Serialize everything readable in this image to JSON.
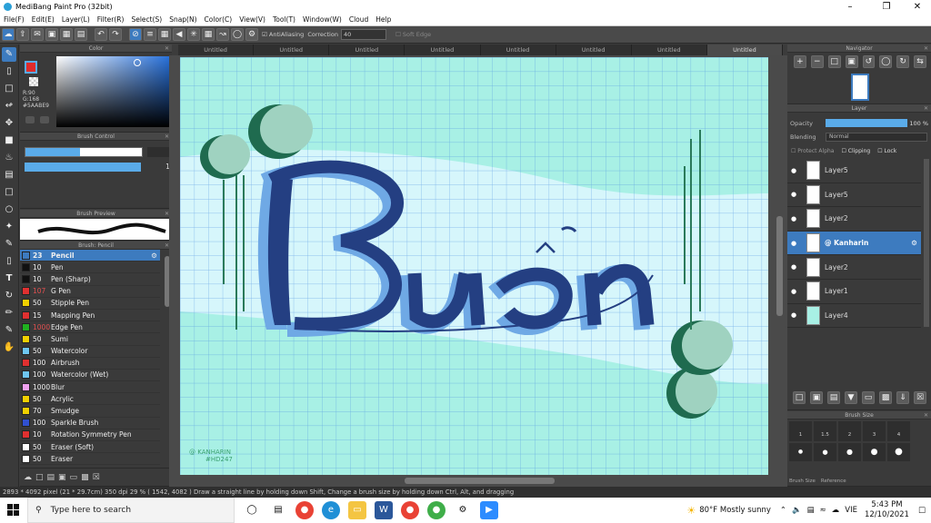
{
  "window": {
    "title": "MediBang Paint Pro (32bit)"
  },
  "menu": [
    "File(F)",
    "Edit(E)",
    "Layer(L)",
    "Filter(R)",
    "Select(S)",
    "Snap(N)",
    "Color(C)",
    "View(V)",
    "Tool(T)",
    "Window(W)",
    "Cloud",
    "Help"
  ],
  "toolbar": {
    "antialias_label": "AntiAliasing",
    "correction_label": "Correction",
    "correction_value": "40",
    "softedge_label": "Soft Edge"
  },
  "tabs": [
    "Untitled",
    "Untitled",
    "Untitled",
    "Untitled",
    "Untitled",
    "Untitled",
    "Untitled",
    "Untitled"
  ],
  "color_panel": {
    "title": "Color",
    "r": "R:90",
    "g": "G:168",
    "hex": "#5AABE9",
    "primary": "#e02b2b"
  },
  "brush_control": {
    "title": "Brush Control",
    "size": "23",
    "opacity": "100 %"
  },
  "brush_preview": {
    "title": "Brush Preview"
  },
  "brush_list": {
    "title": "Brush: Pencil",
    "items": [
      {
        "size": "23",
        "name": "Pencil",
        "color": "#3d7bbf"
      },
      {
        "size": "10",
        "name": "Pen",
        "color": "#111111"
      },
      {
        "size": "10",
        "name": "Pen (Sharp)",
        "color": "#111111"
      },
      {
        "size": "107",
        "name": "G Pen",
        "color": "#e03030"
      },
      {
        "size": "50",
        "name": "Stipple Pen",
        "color": "#f0d000"
      },
      {
        "size": "15",
        "name": "Mapping Pen",
        "color": "#e03030"
      },
      {
        "size": "1000",
        "name": "Edge Pen",
        "color": "#20b020"
      },
      {
        "size": "50",
        "name": "Sumi",
        "color": "#f0d000"
      },
      {
        "size": "50",
        "name": "Watercolor",
        "color": "#6ec6f0"
      },
      {
        "size": "100",
        "name": "Airbrush",
        "color": "#e03030"
      },
      {
        "size": "100",
        "name": "Watercolor (Wet)",
        "color": "#6ec6f0"
      },
      {
        "size": "1000",
        "name": "Blur",
        "color": "#f0a0f0"
      },
      {
        "size": "50",
        "name": "Acrylic",
        "color": "#f0d000"
      },
      {
        "size": "70",
        "name": "Smudge",
        "color": "#f0d000"
      },
      {
        "size": "100",
        "name": "Sparkle Brush",
        "color": "#3050d0"
      },
      {
        "size": "10",
        "name": "Rotation Symmetry Pen",
        "color": "#e03030"
      },
      {
        "size": "50",
        "name": "Eraser (Soft)",
        "color": "#ffffff"
      },
      {
        "size": "50",
        "name": "Eraser",
        "color": "#ffffff"
      }
    ]
  },
  "navigator": {
    "title": "Navigator"
  },
  "layer_panel": {
    "title": "Layer",
    "opacity_label": "Opacity",
    "opacity_value": "100 %",
    "blending_label": "Blending",
    "blending_value": "Normal",
    "protect_alpha": "Protect Alpha",
    "clipping": "Clipping",
    "lock": "Lock",
    "layers": [
      {
        "name": "Layer5"
      },
      {
        "name": "Layer5"
      },
      {
        "name": "Layer2"
      },
      {
        "name": "@ Kanharin"
      },
      {
        "name": "Layer2"
      },
      {
        "name": "Layer1"
      },
      {
        "name": "Layer4"
      }
    ]
  },
  "brush_size_panel": {
    "title": "Brush Size",
    "sizes": [
      "1",
      "1.5",
      "2",
      "3",
      "4"
    ],
    "tab1": "Brush Size",
    "tab2": "Reference"
  },
  "artwork": {
    "word": "Buồn",
    "signature_line1": "@ KANHARIN",
    "signature_line2": "#HD247"
  },
  "status": "2893 * 4092 pixel  (21 * 29.7cm)  350 dpi  29 %  ( 1542, 4082 )  Draw a straight line by holding down Shift, Change a brush size by holding down Ctrl, Alt, and dragging",
  "taskbar": {
    "search_placeholder": "Type here to search",
    "weather": "80°F  Mostly sunny",
    "lang": "VIE",
    "time": "5:43 PM",
    "date": "12/10/2021"
  }
}
